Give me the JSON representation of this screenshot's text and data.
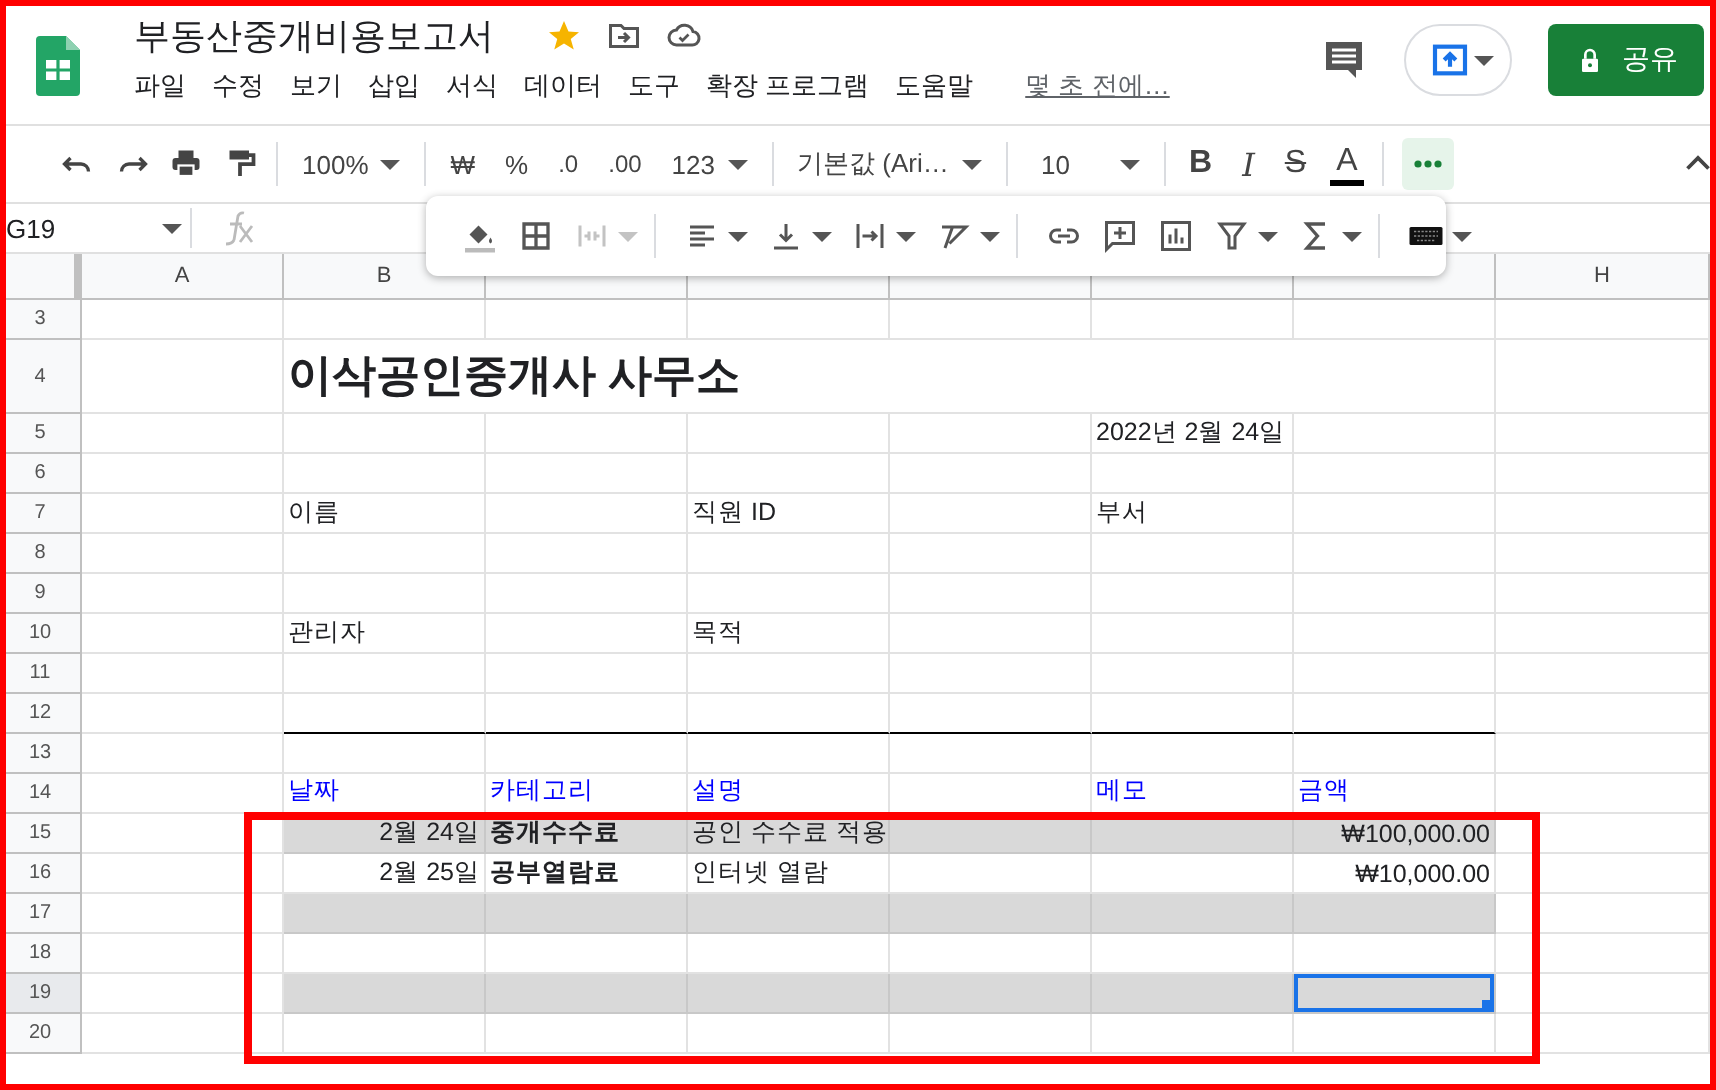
{
  "app": {
    "title": "부동산중개비용보고서",
    "starred": true,
    "menus": [
      "파일",
      "수정",
      "보기",
      "삽입",
      "서식",
      "데이터",
      "도구",
      "확장 프로그램",
      "도움말"
    ],
    "last_edit": "몇 초 전에…",
    "share": "공유"
  },
  "toolbar": {
    "zoom": "100%",
    "currency": "₩",
    "percent": "%",
    "decrease_decimals": ".0",
    "increase_decimals": ".00",
    "number_format": "123",
    "font": "기본값 (Ari…",
    "font_size": "10",
    "bold": "B",
    "italic": "I",
    "strikethrough": "S",
    "text_color": "A",
    "more_active": true
  },
  "formula_bar": {
    "cell": "G19"
  },
  "floating_toolbar": {
    "merge_disabled": true
  },
  "sheet": {
    "columns": [
      {
        "label": "A"
      },
      {
        "label": "B"
      },
      {},
      {},
      {},
      {},
      {},
      {
        "label": "H"
      }
    ],
    "rows": [
      {
        "number": "3"
      },
      {
        "number": "4",
        "cells": {
          "B": {
            "kind": "title",
            "text": "이삭공인중개사 사무소"
          }
        }
      },
      {
        "number": "5",
        "cells": {
          "F": {
            "kind": "plain",
            "text": "2022년 2월 24일"
          }
        }
      },
      {
        "number": "6"
      },
      {
        "number": "7",
        "cells": {
          "B": {
            "kind": "plain",
            "text": "이름"
          },
          "D": {
            "kind": "plain",
            "text": "직원 ID"
          },
          "F": {
            "kind": "plain",
            "text": "부서"
          }
        }
      },
      {
        "number": "8"
      },
      {
        "number": "9"
      },
      {
        "number": "10",
        "cells": {
          "B": {
            "kind": "plain",
            "text": "관리자"
          },
          "D": {
            "kind": "plain",
            "text": "목적"
          }
        }
      },
      {
        "number": "11"
      },
      {
        "number": "12",
        "rule_below": true
      },
      {
        "number": "13"
      },
      {
        "number": "14",
        "cells": {
          "B": {
            "kind": "header",
            "text": "날짜"
          },
          "C": {
            "kind": "header",
            "text": "카테고리"
          },
          "D": {
            "kind": "header",
            "text": "설명"
          },
          "F": {
            "kind": "header",
            "text": "메모"
          },
          "G": {
            "kind": "header",
            "text": "금액"
          }
        }
      },
      {
        "number": "15",
        "shaded": true,
        "cells": {
          "B": {
            "kind": "number",
            "text": "2월 24일"
          },
          "C": {
            "kind": "bold",
            "text": "중개수수료"
          },
          "D": {
            "kind": "plain",
            "text": "공인 수수료 적용"
          },
          "G": {
            "kind": "number",
            "text": "₩100,000.00"
          }
        }
      },
      {
        "number": "16",
        "cells": {
          "B": {
            "kind": "number",
            "text": "2월 25일"
          },
          "C": {
            "kind": "bold",
            "text": "공부열람료"
          },
          "D": {
            "kind": "plain",
            "text": "인터넷 열람"
          },
          "G": {
            "kind": "number",
            "text": "₩10,000.00"
          }
        }
      },
      {
        "number": "17",
        "shaded": true
      },
      {
        "number": "18"
      },
      {
        "number": "19",
        "shaded": true,
        "cells": {
          "G": {
            "selected": true
          }
        }
      },
      {
        "number": "20"
      }
    ]
  },
  "annotations": {
    "page_frame": true,
    "highlight_box": true
  }
}
